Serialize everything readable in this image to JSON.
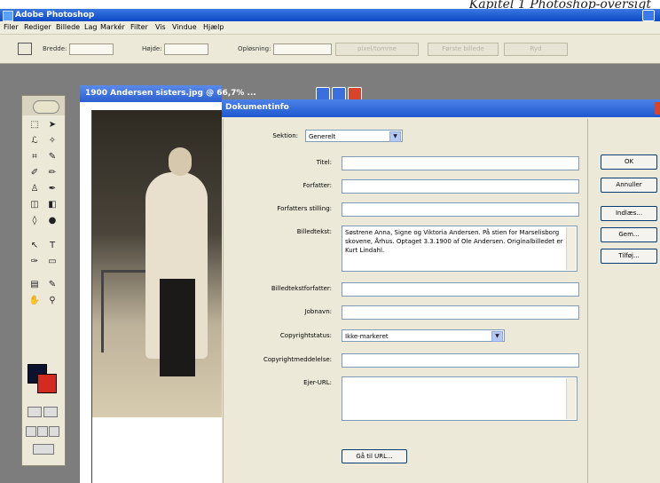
{
  "caption": "Kapitel 1 Photoshop-oversigt",
  "app": {
    "title": "Adobe Photoshop"
  },
  "menu": [
    "Filer",
    "Rediger",
    "Billede",
    "Lag",
    "Markér",
    "Filter",
    "Vis",
    "Vindue",
    "Hjælp"
  ],
  "options": {
    "width_label": "Bredde:",
    "height_label": "Højde:",
    "resolution_label": "Opløsning:",
    "unit_select": "pixel/tomme",
    "front_image_button": "Første billede",
    "clear_button": "Ryd"
  },
  "document": {
    "title": "1900 Andersen sisters.jpg @ 66,7% ..."
  },
  "dialog": {
    "title": "Dokumentinfo",
    "section_label": "Sektion:",
    "section_value": "Generelt",
    "fields": {
      "title": {
        "label": "Titel:",
        "value": ""
      },
      "author": {
        "label": "Forfatter:",
        "value": ""
      },
      "author_title": {
        "label": "Forfatters stilling:",
        "value": ""
      },
      "caption": {
        "label": "Billedtekst:",
        "value": "Søstrene Anna, Signe og Viktoria Andersen. På stien for Marselisborg skovene, Århus. Optaget 3.3.1900 af Ole Andersen. Originalbilledet er Kurt Lindahl."
      },
      "caption_writer": {
        "label": "Billedtekstforfatter:",
        "value": ""
      },
      "job_name": {
        "label": "Jobnavn:",
        "value": ""
      },
      "copyright_status": {
        "label": "Copyrightstatus:",
        "value": "Ikke-markeret"
      },
      "copyright_notice": {
        "label": "Copyrightmeddelelse:",
        "value": ""
      },
      "owner_url": {
        "label": "Ejer-URL:",
        "value": ""
      }
    },
    "goto_url_button": "Gå til URL...",
    "buttons": {
      "ok": "OK",
      "cancel": "Annuller",
      "load": "Indlæs...",
      "save": "Gem...",
      "append": "Tilføj..."
    }
  },
  "colors": {
    "foreground": "#0b1230",
    "background": "#d42a20",
    "titlebar": "#0d48c6"
  }
}
